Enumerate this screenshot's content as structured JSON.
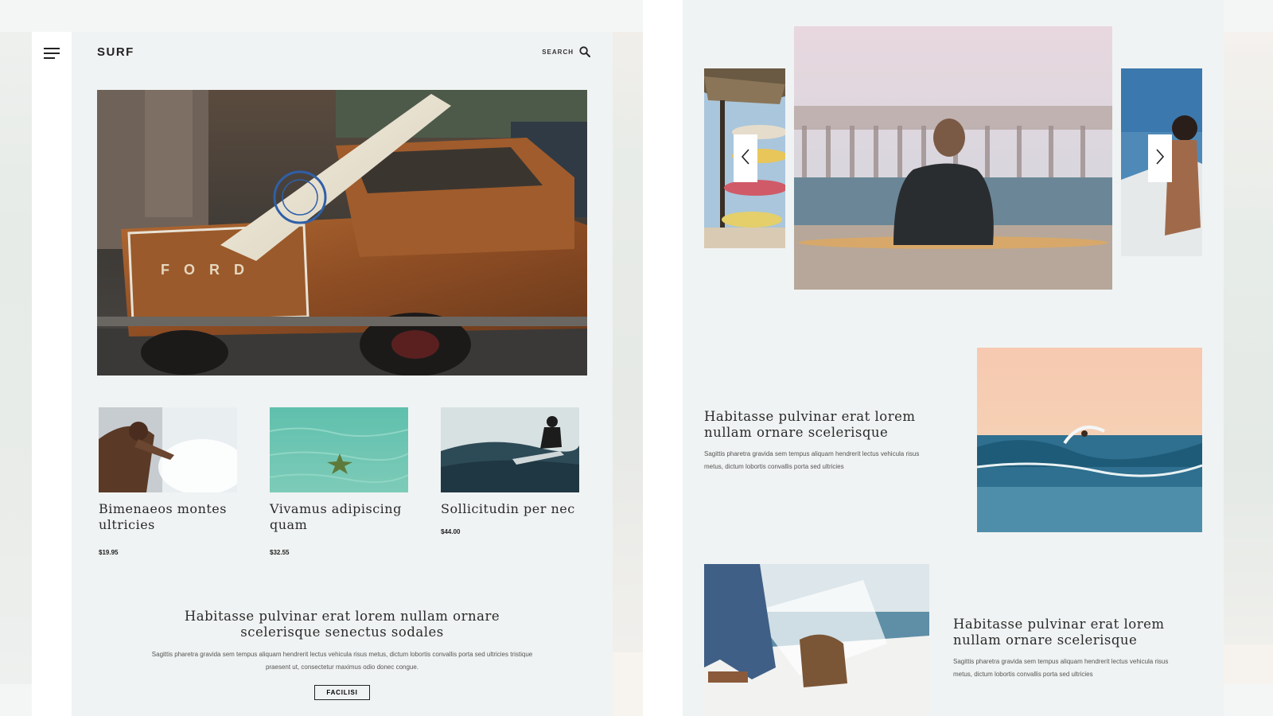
{
  "header": {
    "brand": "SURF",
    "search_label": "SEARCH"
  },
  "products": [
    {
      "title": "Bimenaeos montes ultricies",
      "price": "$19.95"
    },
    {
      "title": "Vivamus adipiscing quam",
      "price": "$32.55"
    },
    {
      "title": "Sollicitudin per nec",
      "price": "$44.00"
    }
  ],
  "intro": {
    "title": "Habitasse pulvinar erat lorem nullam ornare scelerisque senectus sodales",
    "text": "Sagittis pharetra gravida sem tempus aliquam hendrerit lectus vehicula risus metus, dictum lobortis convallis porta sed ultricies tristique praesent ut, consectetur maximus odio donec congue.",
    "cta_label": "FACILISI"
  },
  "features": [
    {
      "title": "Habitasse pulvinar erat lorem nullam ornare scelerisque",
      "text": "Sagittis pharetra gravida sem tempus aliquam hendrerit lectus vehicula risus metus, dictum lobortis convallis porta sed ultricies"
    },
    {
      "title": "Habitasse pulvinar erat lorem nullam ornare scelerisque",
      "text": "Sagittis pharetra gravida sem tempus aliquam hendrerit lectus vehicula risus metus, dictum lobortis convallis porta sed ultricies"
    }
  ],
  "icons": {
    "menu": "hamburger-menu-icon",
    "search": "search-icon",
    "prev": "chevron-left-icon",
    "next": "chevron-right-icon"
  },
  "colors": {
    "page_bg": "#f0f3f3",
    "text": "#222222",
    "sidebar": "#ffffff"
  }
}
